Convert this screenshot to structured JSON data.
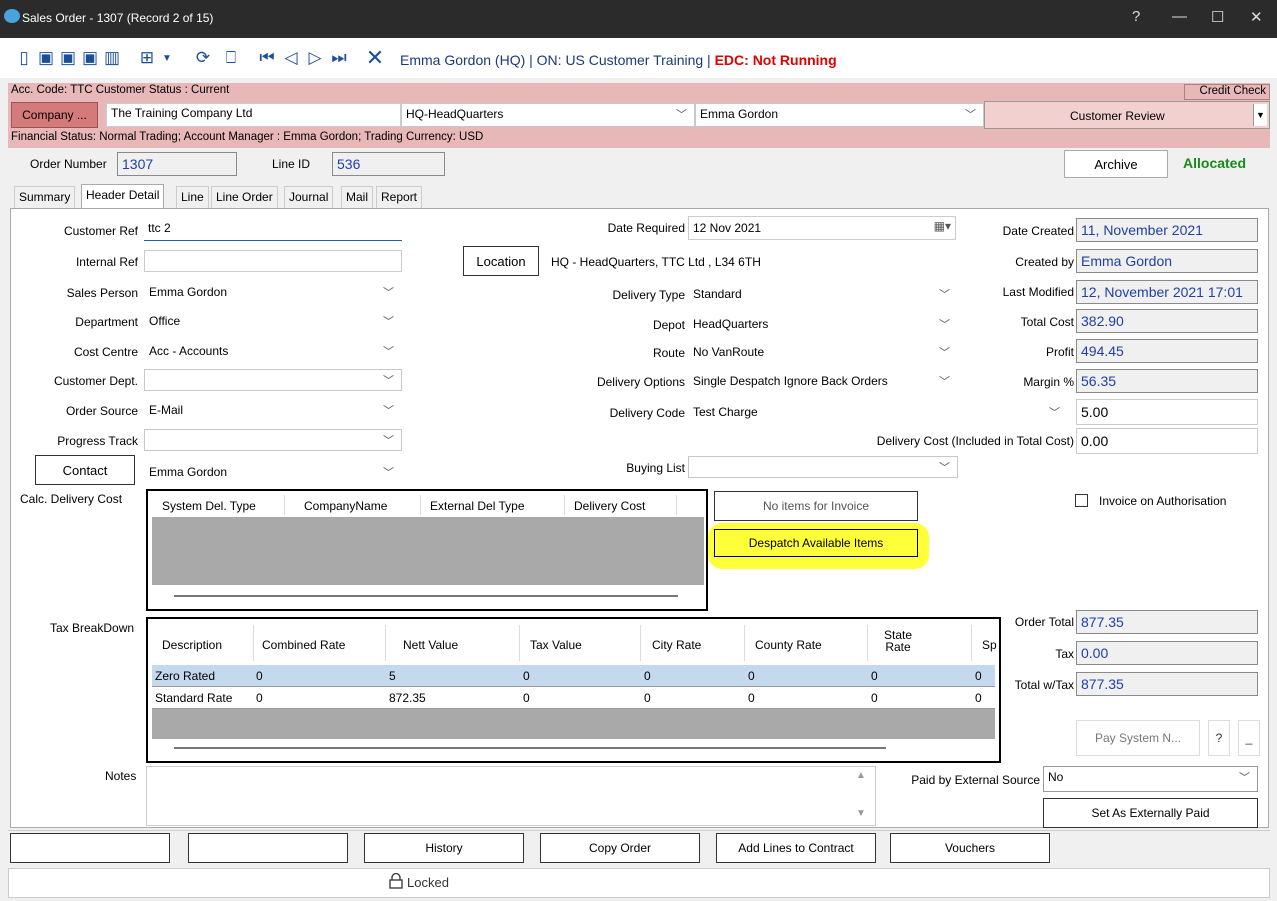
{
  "window": {
    "title": "Sales Order - 1307  (Record 2 of 15)",
    "help": "?",
    "minimize": "—",
    "maximize": "☐",
    "close": "✕"
  },
  "toolbar": {
    "user": "Emma Gordon (HQ) | ON: US Customer Training | ",
    "edc": "EDC: Not Running"
  },
  "account": {
    "info": "Acc. Code: TTC  Customer Status : Current",
    "credit_check": "Credit Check",
    "company_button": "Company ...",
    "company_name": "The Training Company Ltd",
    "site": "HQ-HeadQuarters",
    "manager": "Emma Gordon",
    "review": "Customer Review",
    "financial": "Financial Status: Normal Trading;  Account Manager : Emma Gordon; Trading Currency: USD"
  },
  "order": {
    "number_label": "Order Number",
    "number": "1307",
    "line_label": "Line ID",
    "line_id": "536",
    "archive": "Archive",
    "status": "Allocated"
  },
  "tabs": [
    "Summary",
    "Header Detail",
    "Line",
    "Line Order",
    "Journal",
    "Mail",
    "Report"
  ],
  "left": {
    "customer_ref_label": "Customer Ref",
    "customer_ref": "ttc 2",
    "internal_ref_label": "Internal Ref",
    "internal_ref": "",
    "sales_person_label": "Sales Person",
    "sales_person": "Emma Gordon",
    "department_label": "Department",
    "department": "Office",
    "cost_centre_label": "Cost Centre",
    "cost_centre": "Acc - Accounts",
    "customer_dept_label": "Customer Dept.",
    "customer_dept": "",
    "order_source_label": "Order Source",
    "order_source": "E-Mail",
    "progress_track_label": "Progress Track",
    "progress_track": "",
    "contact_button": "Contact",
    "contact": "Emma Gordon",
    "calc_delivery_label": "Calc. Delivery Cost",
    "tax_breakdown_label": "Tax BreakDown",
    "notes_label": "Notes"
  },
  "middle": {
    "date_required_label": "Date Required",
    "date_required": "12 Nov 2021",
    "location_button": "Location",
    "location": "HQ - HeadQuarters, TTC Ltd , L34 6TH",
    "delivery_type_label": "Delivery Type",
    "delivery_type": "Standard",
    "depot_label": "Depot",
    "depot": "HeadQuarters",
    "route_label": "Route",
    "route": "No VanRoute",
    "delivery_options_label": "Delivery Options",
    "delivery_options": "Single Despatch Ignore Back Orders",
    "delivery_code_label": "Delivery Code",
    "delivery_code": "Test Charge",
    "delivery_code_value": "5.00",
    "delivery_cost_label": "Delivery Cost (Included in Total Cost)",
    "delivery_cost": "0.00",
    "buying_list_label": "Buying List",
    "buying_list": "",
    "no_items_button": "No items for Invoice",
    "despatch_button": "Despatch Available Items"
  },
  "right": {
    "date_created_label": "Date Created",
    "date_created": "11, November 2021",
    "created_by_label": "Created by",
    "created_by": "Emma Gordon",
    "last_modified_label": "Last Modified",
    "last_modified": "12, November 2021  17:01",
    "total_cost_label": "Total Cost",
    "total_cost": "382.90",
    "profit_label": "Profit",
    "profit": "494.45",
    "margin_label": "Margin %",
    "margin": "56.35",
    "invoice_auth": "Invoice on Authorisation",
    "order_total_label": "Order Total",
    "order_total": "877.35",
    "tax_label": "Tax",
    "tax": "0.00",
    "total_tax_label": "Total w/Tax",
    "total_tax": "877.35",
    "pay_system": "Pay System N...",
    "help": "?",
    "minus": "_",
    "paid_external_label": "Paid by External Source",
    "paid_external": "No",
    "set_paid": "Set As Externally Paid"
  },
  "delivery_grid": {
    "columns": [
      "System Del. Type",
      "CompanyName",
      "External Del Type",
      "Delivery Cost"
    ]
  },
  "tax_grid": {
    "columns": [
      "Description",
      "Combined Rate",
      "Nett Value",
      "Tax Value",
      "City Rate",
      "County Rate",
      "State Rate",
      "Sp"
    ],
    "rows": [
      [
        "Zero Rated",
        "0",
        "5",
        "0",
        "0",
        "0",
        "0",
        "0"
      ],
      [
        "Standard Rate",
        "0",
        "872.35",
        "0",
        "0",
        "0",
        "0",
        "0"
      ]
    ]
  },
  "bottom": {
    "history": "History",
    "copy_order": "Copy Order",
    "add_lines": "Add Lines to Contract",
    "vouchers": "Vouchers"
  },
  "status": {
    "locked": "Locked"
  },
  "colors": {
    "account_bg": "#e8b7b7",
    "allocated": "#1a8a1a",
    "highlight": "#ffff3a",
    "link_text": "#1e3fa8"
  }
}
